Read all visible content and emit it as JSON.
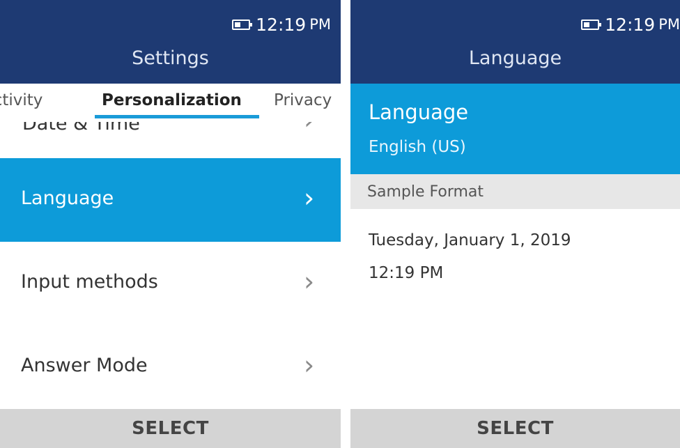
{
  "left_screen": {
    "status": {
      "time": "12:19",
      "ampm": "PM",
      "battery_icon": "battery-icon"
    },
    "title": "Settings",
    "tabs": [
      "nectivity",
      "Personalization",
      "Privacy"
    ],
    "active_tab": "Personalization",
    "partial_item": "Date & Time",
    "items": [
      {
        "label": "Language",
        "selected": true
      },
      {
        "label": "Input methods",
        "selected": false
      },
      {
        "label": "Answer Mode",
        "selected": false
      }
    ],
    "softkey": "SELECT"
  },
  "right_screen": {
    "status": {
      "time": "12:19",
      "ampm": "PM",
      "battery_icon": "battery-icon"
    },
    "title": "Language",
    "language_label": "Language",
    "language_value": "English (US)",
    "section_header": "Sample Format",
    "sample_date": "Tuesday, January 1, 2019",
    "sample_time": "12:19 PM",
    "softkey": "SELECT"
  },
  "colors": {
    "header_bg": "#1e3a73",
    "accent": "#0d9bd9",
    "tab_underline": "#1a9bd8",
    "softkey_bg": "#d4d4d4",
    "section_bg": "#e7e7e7"
  }
}
